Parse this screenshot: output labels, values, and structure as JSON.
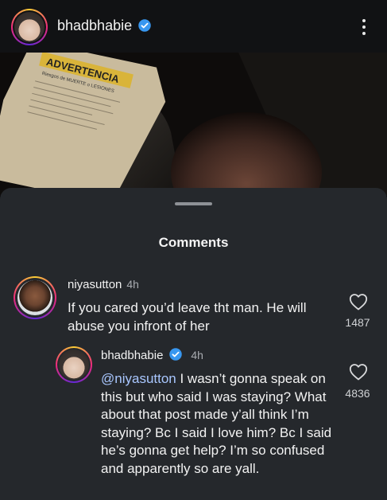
{
  "post": {
    "username": "bhadbhabie",
    "verified": true,
    "more_icon": "more-vertical-icon",
    "photo_sign_text": "ADVERTENCIA",
    "photo_sign_subtext": "Riesgos de MUERTE o LESIONES"
  },
  "comments_sheet": {
    "title": "Comments",
    "comments": [
      {
        "username": "niyasutton",
        "time": "4h",
        "text": "If you cared you’d leave tht man. He will abuse you infront of her",
        "likes": "1487"
      }
    ],
    "reply": {
      "username": "bhadbhabie",
      "verified": true,
      "time": "4h",
      "mention": "@niyasutton",
      "text": " I wasn’t gonna speak on this but who said I was staying? What about that post made y’all think I’m staying? Bc I said I love him? Bc I said he’s gonna get help? I’m so confused and apparently so are yall.",
      "likes": "4836"
    }
  },
  "colors": {
    "sheet_bg": "#25282c",
    "header_bg": "#111214",
    "mention": "#a9c7ff",
    "verified_badge": "#3897f0"
  }
}
